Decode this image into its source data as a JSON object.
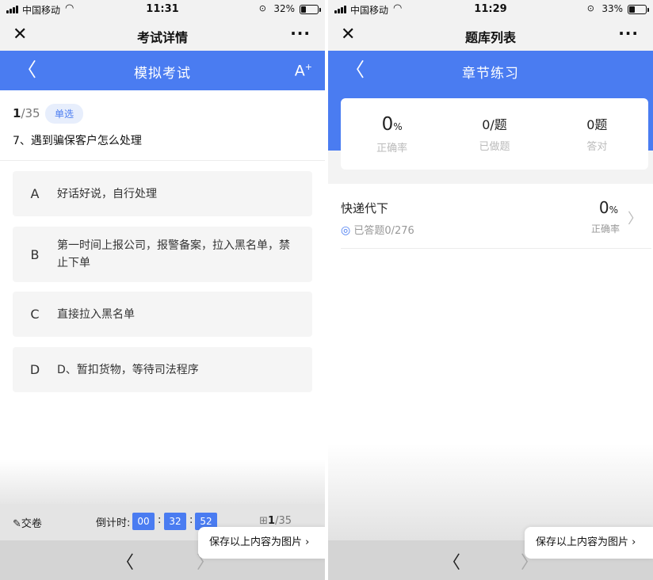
{
  "left": {
    "status": {
      "carrier": "中国移动",
      "time": "11:31",
      "battery": "32%",
      "battery_level": 0.32
    },
    "wx": {
      "title": "考试详情",
      "close": "✕",
      "more": "···"
    },
    "header": {
      "title": "模拟考试",
      "font_btn": "A",
      "font_sup": "+"
    },
    "question": {
      "index": "1",
      "total": "/35",
      "type": "单选",
      "text": "7、遇到骗保客户怎么处理",
      "options": [
        {
          "letter": "A",
          "text": "好话好说，自行处理"
        },
        {
          "letter": "B",
          "text": "第一时间上报公司，报警备案，拉入黑名单，禁止下单"
        },
        {
          "letter": "C",
          "text": "直接拉入黑名单"
        },
        {
          "letter": "D",
          "text": "D、暂扣货物，等待司法程序"
        }
      ]
    },
    "toolbar": {
      "submit": "交卷",
      "countdown_label": "倒计时:",
      "hh": "00",
      "mm": "32",
      "ss": "52",
      "count_current": "1",
      "count_total": "/35"
    },
    "save": "保存以上内容为图片 ›"
  },
  "right": {
    "status": {
      "carrier": "中国移动",
      "time": "11:29",
      "battery": "33%",
      "battery_level": 0.33
    },
    "wx": {
      "title": "题库列表",
      "close": "✕",
      "more": "···"
    },
    "header": {
      "title": "章节练习"
    },
    "stats": [
      {
        "value": "0",
        "unit": "%",
        "label": "正确率"
      },
      {
        "value": "0",
        "unit": "/题",
        "label": "已做题"
      },
      {
        "value": "0",
        "unit": "题",
        "label": "答对"
      }
    ],
    "chapter": {
      "name": "快递代下",
      "progress": "已答题0/276",
      "rate": "0",
      "rate_unit": "%",
      "rate_label": "正确率"
    },
    "save": "保存以上内容为图片 ›"
  },
  "colors": {
    "accent": "#4a7cf1",
    "badge_bg": "#e7eefc",
    "option_bg": "#f5f5f5"
  }
}
